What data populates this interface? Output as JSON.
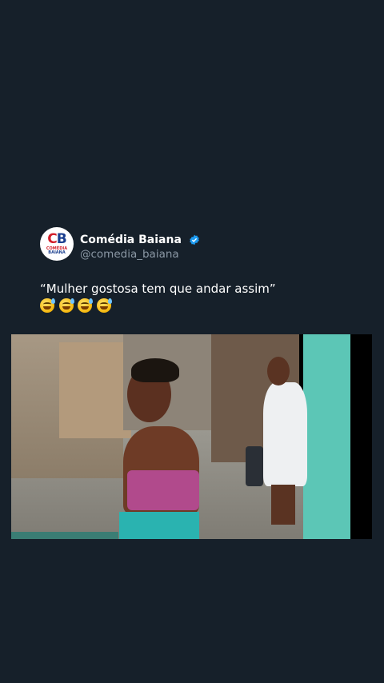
{
  "tweet": {
    "author": {
      "display_name": "Comédia Baiana",
      "handle": "@comedia_baiana",
      "verified": true,
      "avatar_text": "CB",
      "avatar_sub": [
        "COMÉDIA",
        "BAIANA"
      ]
    },
    "text": "“Mulher gostosa tem que andar assim”",
    "emojis": [
      "grinning-face-with-sweat",
      "grinning-face-with-sweat",
      "grinning-face-with-sweat",
      "grinning-face-with-sweat"
    ]
  },
  "colors": {
    "background": "#16202a",
    "verified_badge": "#1d9bf0",
    "handle_gray": "#8b98a5"
  }
}
